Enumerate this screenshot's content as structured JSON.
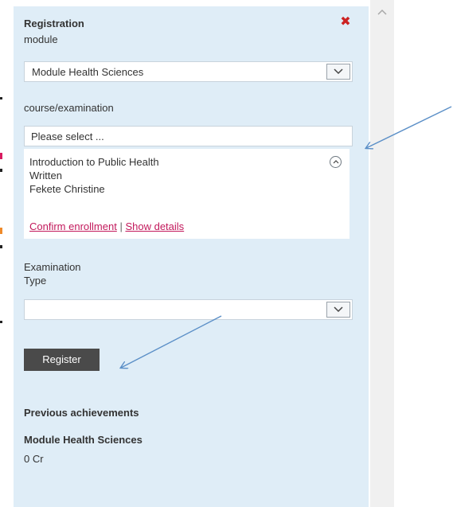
{
  "panel": {
    "title": "Registration",
    "close_icon": "close-icon",
    "module_label": "module",
    "module_select_value": "Module Health Sciences",
    "course_label": "course/examination",
    "course_placeholder": "Please select ...",
    "course": {
      "name": "Introduction to Public Health",
      "exam_type": "Written",
      "lecturer": "Fekete Christine"
    },
    "confirm_link": "Confirm enrollment",
    "link_separator": "|",
    "details_link": "Show details",
    "exam_type_label_line1": "Examination",
    "exam_type_label_line2": "Type",
    "exam_type_select_value": "",
    "register_button": "Register",
    "previous_heading": "Previous achievements",
    "previous_module": "Module Health Sciences",
    "previous_credits": "0 Cr"
  },
  "colors": {
    "panel_bg": "#dfedf7",
    "link": "#c2185b",
    "button_bg": "#4a4a4a",
    "close": "#cc2222",
    "annotation_arrow": "#5b8fc7",
    "edge_mark_pink": "#d81b60",
    "edge_mark_orange": "#ef8a2a"
  },
  "icons": {
    "dropdown": "chevron-down-icon",
    "collapse": "chevron-up-circle-icon",
    "scroll_up": "scroll-up-icon"
  }
}
